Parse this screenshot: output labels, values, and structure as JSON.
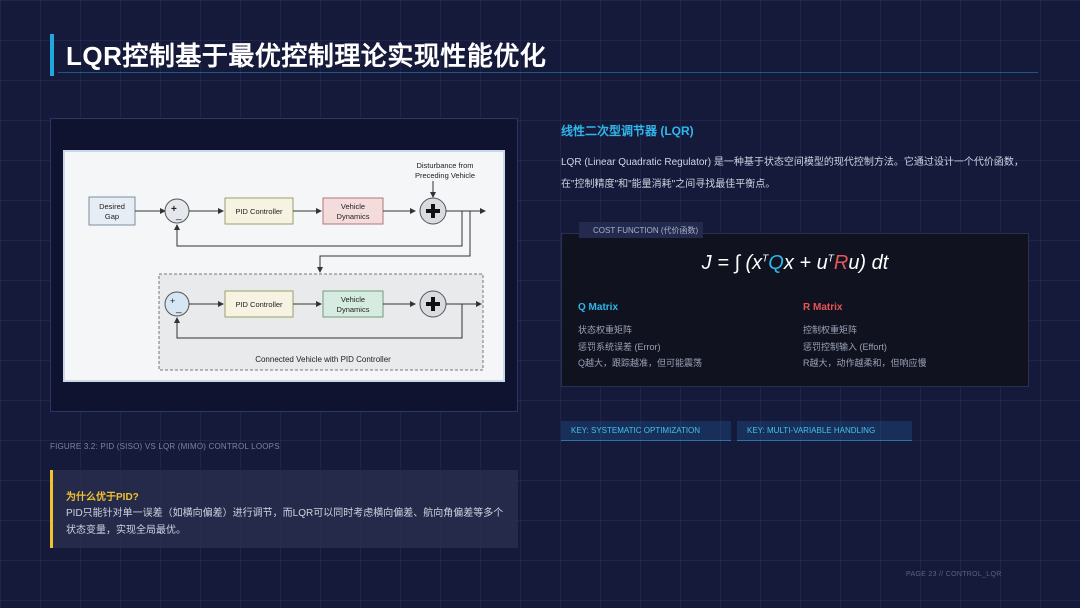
{
  "header": {
    "title": "LQR控制基于最优控制理论实现性能优化"
  },
  "figure": {
    "caption": "FIGURE 3.2: PID (SISO) VS LQR (MIMO) CONTROL LOOPS",
    "diagram": {
      "desired_gap_line1": "Desired",
      "desired_gap_line2": "Gap",
      "pid_controller": "PID Controller",
      "vehicle_line1": "Vehicle",
      "vehicle_line2": "Dynamics",
      "disturbance_line1": "Disturbance from",
      "disturbance_line2": "Preceding Vehicle",
      "sum_plus": "+",
      "sum_minus": "_",
      "connected_label": "Connected Vehicle with PID Controller"
    }
  },
  "why": {
    "title": "为什么优于PID?",
    "body": "PID只能针对单一误差（如横向偏差）进行调节，而LQR可以同时考虑横向偏差、航向角偏差等多个状态变量，实现全局最优。"
  },
  "lqr": {
    "heading": "线性二次型调节器 (LQR)",
    "description": "LQR (Linear Quadratic Regulator) 是一种基于状态空间模型的现代控制方法。它通过设计一个代价函数，在\"控制精度\"和\"能量消耗\"之间寻找最佳平衡点。"
  },
  "cost": {
    "label": "COST FUNCTION (代价函数)",
    "formula": {
      "prefix": "J = ∫ (x",
      "sup1": "T",
      "q": "Q",
      "mid": "x + u",
      "sup2": "T",
      "r": "R",
      "suffix": "u) dt"
    },
    "q_matrix": {
      "title": "Q Matrix",
      "line1": "状态权重矩阵",
      "line2": "惩罚系统误差 (Error)",
      "line3": "Q越大，跟踪越准，但可能震荡"
    },
    "r_matrix": {
      "title": "R Matrix",
      "line1": "控制权重矩阵",
      "line2": "惩罚控制输入 (Effort)",
      "line3": "R越大，动作越柔和，但响应慢"
    }
  },
  "keys": [
    "KEY: SYSTEMATIC OPTIMIZATION",
    "KEY: MULTI-VARIABLE HANDLING"
  ],
  "footer": {
    "page": "PAGE 23 // CONTROL_LQR"
  },
  "colors": {
    "accent_blue": "#2fb6ea",
    "accent_red": "#e8545a",
    "accent_yellow": "#f2c12e",
    "background": "#15193a"
  }
}
